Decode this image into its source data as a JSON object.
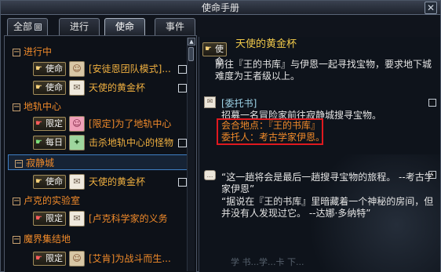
{
  "window": {
    "title": "使命手册",
    "close_glyph": "✕"
  },
  "tabs": [
    {
      "label": "全部",
      "dropmark": "⊞"
    },
    {
      "label": "进行"
    },
    {
      "label": "使命"
    },
    {
      "label": "事件"
    }
  ],
  "left": {
    "groups": [
      {
        "label": "进行中",
        "toggle": "−"
      },
      {
        "label": "地轨中心",
        "toggle": "−"
      },
      {
        "label": "寂静城",
        "toggle": "−"
      },
      {
        "label": "卢克的实验室",
        "toggle": "−"
      },
      {
        "label": "魔界集结地",
        "toggle": "−"
      }
    ],
    "rows": [
      {
        "badge": "使命",
        "task": "[安徒恩团队模式]..."
      },
      {
        "badge": "使命",
        "task": "天使的黄金杯"
      },
      {
        "badge": "限定",
        "task": "[限定]为了地轨中心"
      },
      {
        "badge": "每日",
        "task": "击杀地轨中心的怪物"
      },
      {
        "badge": "使命",
        "task": "天使的黄金杯"
      },
      {
        "badge": "限定",
        "task": "[卢克科学家的义务"
      },
      {
        "badge": "限定",
        "task": "[艾肯]为战斗而生..."
      }
    ],
    "scroll_up_glyph": "▲"
  },
  "detail": {
    "badge": "使命",
    "title": "天使的黄金杯",
    "description": "前往『王的书库』与伊恩一起寻找宝物，要求地下城难度为王者级以上。",
    "letter_title": "[委托书]",
    "letter_body": "招募一名冒险家前往寂静城搜寻宝物。",
    "meet_place": "会合地点：『王的书库』",
    "client": "委托人：考古学家伊恩。",
    "quote1": "“这一趟将会是最后一趟搜寻宝物的旅程。 --考古学家伊恩”",
    "quote2": "“据说在『王的书库』里暗藏着一个神秘的房间，但并没有人发现过它。 --达娜·多纳特”",
    "faded_text": "学 书...学...卡 下..."
  },
  "colors": {
    "accent_orange": "#f08a2a",
    "task_gold": "#f0b040",
    "title_gold": "#f0c84a",
    "highlight_red": "#e0191f",
    "selection_blue": "#3f7fc4"
  },
  "icons": {
    "mission": "hand-icon",
    "portrait": "npc-portrait-icon",
    "letter": "scroll-icon",
    "speech": "speech-bubble-icon"
  }
}
